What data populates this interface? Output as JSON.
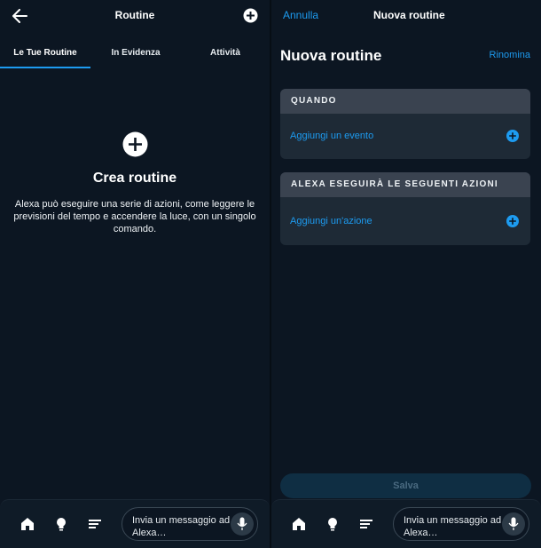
{
  "left": {
    "header": {
      "title": "Routine"
    },
    "tabs": [
      {
        "label": "Le Tue Routine",
        "active": true
      },
      {
        "label": "In Evidenza",
        "active": false
      },
      {
        "label": "Attività",
        "active": false
      }
    ],
    "empty_state": {
      "title": "Crea routine",
      "description": "Alexa può eseguire una serie di azioni, come leggere le previsioni del tempo e accendere la luce, con un singolo comando."
    },
    "bottom_bar": {
      "message_placeholder": "Invia un messaggio ad Alexa…"
    }
  },
  "right": {
    "header": {
      "cancel_label": "Annulla",
      "title": "Nuova routine"
    },
    "page_title": "Nuova routine",
    "rename_label": "Rinomina",
    "when_card": {
      "header": "QUANDO",
      "add_label": "Aggiungi un evento"
    },
    "actions_card": {
      "header": "ALEXA ESEGUIRÀ LE SEGUENTI AZIONI",
      "add_label": "Aggiungi un'azione"
    },
    "save_label": "Salva",
    "bottom_bar": {
      "message_placeholder": "Invia un messaggio ad Alexa…"
    }
  },
  "icons": [
    "back-arrow-icon",
    "plus-circle-icon",
    "home-icon",
    "lightbulb-icon",
    "list-icon",
    "microphone-icon"
  ],
  "colors": {
    "background": "#0c1622",
    "accent": "#1d9bf0",
    "card": "#1e2a36",
    "card_header": "#3a4350"
  }
}
